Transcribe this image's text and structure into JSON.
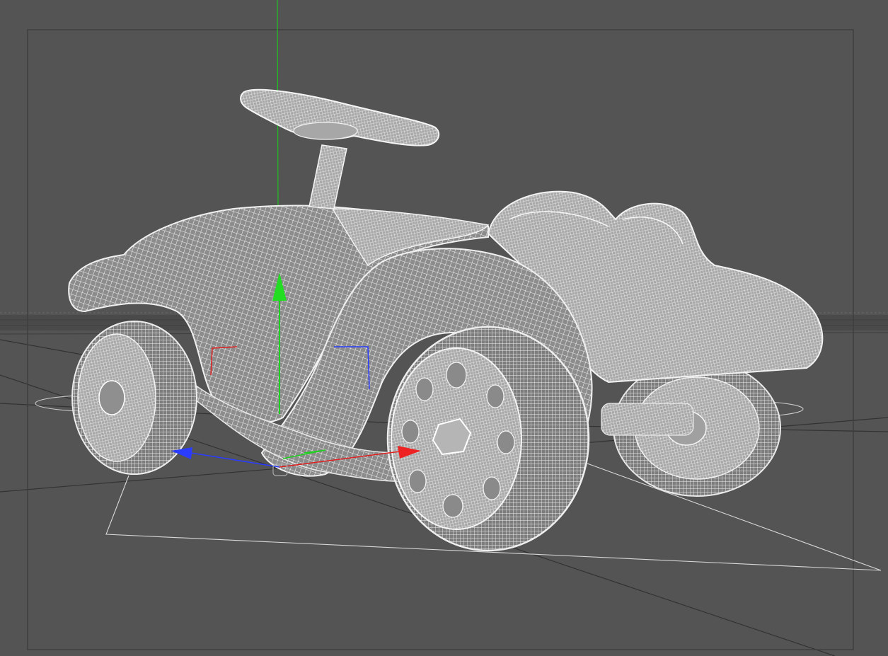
{
  "viewport": {
    "background_color": "#545454",
    "safe_frame_color": "#3e3e3e",
    "grid_color": "#2f2f2f",
    "wireframe_color": "#e6e6e6",
    "wireframe_fill": "#9a9a9a",
    "axis_colors": {
      "x": "#e02020",
      "y": "#20d020",
      "z": "#2a3cff"
    },
    "object": "toy-ride-on-car-wireframe",
    "icons": [
      "move-gizmo-icon",
      "world-y-axis-icon",
      "camera-frustum-icon",
      "target-null-icon"
    ]
  }
}
